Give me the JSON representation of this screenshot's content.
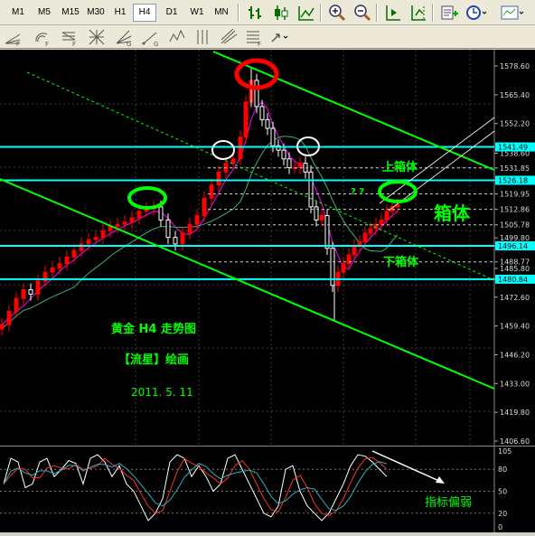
{
  "timeframes": [
    "M1",
    "M5",
    "M15",
    "M30",
    "H1",
    "H4",
    "D1",
    "W1",
    "MN"
  ],
  "active_timeframe": "H4",
  "price_axis": {
    "ticks": [
      "1578.60",
      "1565.40",
      "1552.20",
      "1538.60",
      "1531.85",
      "1526.18",
      "1519.95",
      "1512.86",
      "1505.78",
      "1499.80",
      "1496.14",
      "1488.77",
      "1485.80",
      "1480.84",
      "1472.60",
      "1459.40",
      "1446.20",
      "1433.00",
      "1419.80",
      "1406.60"
    ],
    "highlighted": [
      "1541.49",
      "1526.18",
      "1496.14",
      "1480.84"
    ]
  },
  "osc_axis": {
    "ticks": [
      "105",
      "80",
      "50",
      "20",
      "0"
    ]
  },
  "annotations": {
    "upper_box": "上箱体",
    "box": "箱体",
    "lower_box": "下箱体",
    "question": "? ?",
    "title": "黄金  H4  走势图",
    "author": "【流星】绘画",
    "date": "2011. 5. 11",
    "indicator_note": "指标偏弱"
  },
  "colors": {
    "chart_bg": "#000000",
    "bull_candle": "#ff0000",
    "bear_candle": "#ffffff",
    "level_line": "#00ffff",
    "channel": "#00ff00",
    "annotation_green": "#00ff00",
    "circle_red": "#ff0000",
    "circle_green": "#00ff00",
    "circle_white": "#ffffff",
    "highlight_label_bg": "#00ffff"
  }
}
